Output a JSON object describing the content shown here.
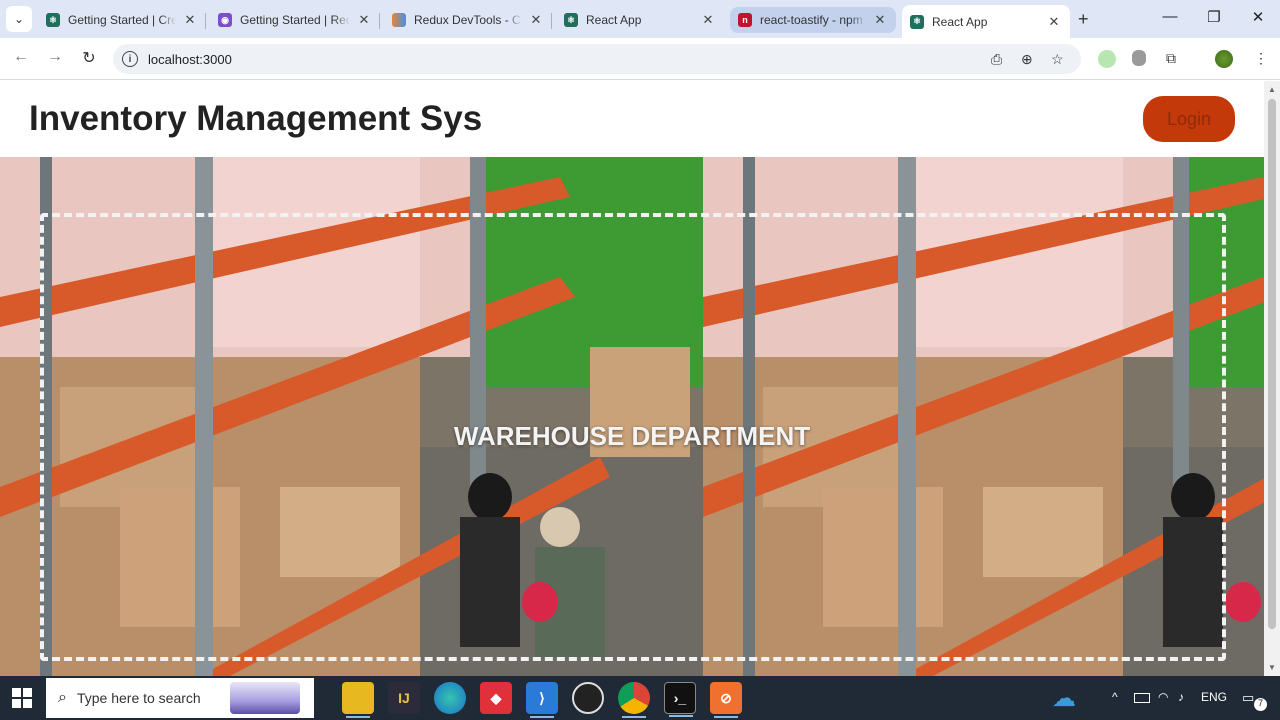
{
  "browser": {
    "tabs": [
      {
        "title": "Getting Started | Create",
        "close": "✕",
        "favicon_color": "#1f6f5c"
      },
      {
        "title": "Getting Started | Redux",
        "close": "✕",
        "favicon_color": "#7b4fc7"
      },
      {
        "title": "Redux DevTools - Chrome",
        "close": "✕",
        "favicon_color": "#e3863b"
      },
      {
        "title": "React App",
        "close": "✕",
        "favicon_color": "#1f6f5c"
      },
      {
        "title": "react-toastify - npm",
        "close": "✕",
        "favicon_color": "#c2132e"
      },
      {
        "title": "React App",
        "close": "✕",
        "favicon_color": "#1f6f5c"
      }
    ],
    "new_tab": "+",
    "window_controls": {
      "minimize": "—",
      "restore": "❐",
      "close": "✕"
    },
    "nav": {
      "back": "←",
      "forward": "→",
      "reload": "↻"
    },
    "url": "localhost:3000"
  },
  "app": {
    "title": "Inventory Management Sys",
    "login_label": "Login",
    "hero_text": "WAREHOUSE DEPARTMENT",
    "accent_color": "#c4390a"
  },
  "taskbar": {
    "search_placeholder": "Type here to search",
    "language": "ENG",
    "notification_count": "7",
    "chevron": "^"
  }
}
